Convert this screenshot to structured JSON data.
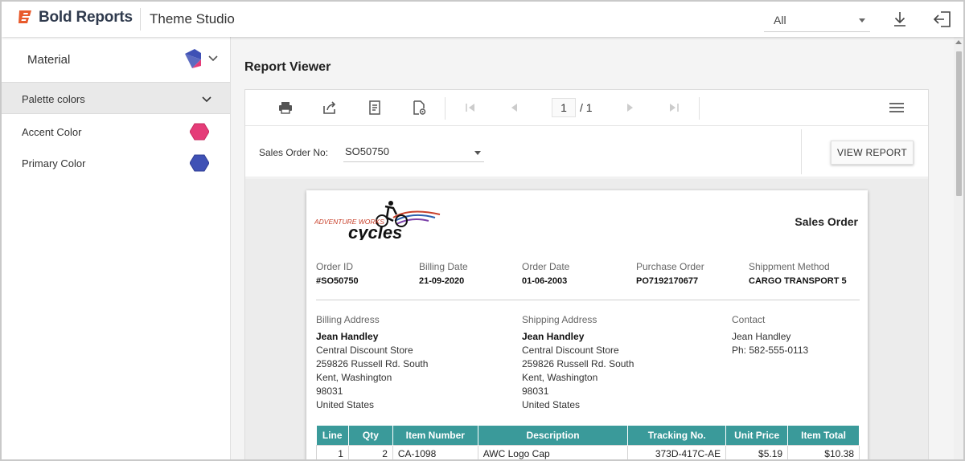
{
  "header": {
    "brand": "Bold Reports",
    "app_title": "Theme Studio",
    "filter_value": "All",
    "brand_color": "#e85a2b"
  },
  "sidebar": {
    "theme_name": "Material",
    "section_label": "Palette colors",
    "colors": [
      {
        "label": "Accent Color",
        "color": "#e53c78"
      },
      {
        "label": "Primary Color",
        "color": "#3f51b5"
      }
    ]
  },
  "main": {
    "title": "Report Viewer"
  },
  "viewer": {
    "current_page": "1",
    "total_pages": "/ 1",
    "param_label": "Sales Order No:",
    "param_value": "SO50750",
    "view_report_label": "VIEW REPORT"
  },
  "report": {
    "logo_text_top": "ADVENTURE WORKS",
    "logo_text_bottom": "cycles",
    "title": "Sales Order",
    "fields": [
      {
        "label": "Order ID",
        "value": "#SO50750"
      },
      {
        "label": "Billing Date",
        "value": "21-09-2020"
      },
      {
        "label": "Order Date",
        "value": "01-06-2003"
      },
      {
        "label": "Purchase Order",
        "value": "PO7192170677"
      },
      {
        "label": "Shippment Method",
        "value": "CARGO TRANSPORT 5"
      }
    ],
    "billing": {
      "label": "Billing Address",
      "name": "Jean Handley",
      "lines": [
        "Central Discount Store",
        "259826 Russell Rd. South",
        "Kent, Washington",
        "98031",
        "United States"
      ]
    },
    "shipping": {
      "label": "Shipping Address",
      "name": "Jean Handley",
      "lines": [
        "Central Discount Store",
        "259826 Russell Rd. South",
        "Kent, Washington",
        "98031",
        "United States"
      ]
    },
    "contact": {
      "label": "Contact",
      "name": "Jean Handley",
      "phone": "Ph: 582-555-0113"
    },
    "table": {
      "headers": [
        "Line",
        "Qty",
        "Item Number",
        "Description",
        "Tracking No.",
        "Unit Price",
        "Item Total"
      ],
      "rows": [
        [
          "1",
          "2",
          "CA-1098",
          "AWC Logo Cap",
          "373D-417C-AE",
          "$5.19",
          "$10.38"
        ]
      ],
      "header_color": "#3a9a9a"
    }
  }
}
